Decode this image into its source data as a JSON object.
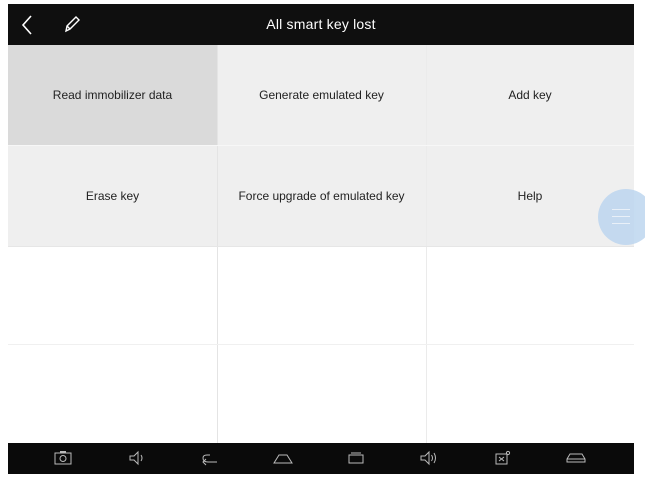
{
  "header": {
    "title": "All smart key lost",
    "back_icon": "chevron-left-icon",
    "edit_icon": "pencil-icon"
  },
  "menu": {
    "items": [
      {
        "label": "Read immobilizer data"
      },
      {
        "label": "Generate emulated key"
      },
      {
        "label": "Add key"
      },
      {
        "label": "Erase key"
      },
      {
        "label": "Force upgrade of emulated key"
      },
      {
        "label": "Help"
      }
    ]
  },
  "navbar": {
    "icons": [
      "screenshot-icon",
      "volume-down-icon",
      "back-icon",
      "home-icon",
      "recent-apps-icon",
      "volume-up-icon",
      "vci-icon",
      "vehicle-icon"
    ]
  },
  "colors": {
    "topbar": "#0f0f0f",
    "tile": "#efefef",
    "tile_active": "#dadada",
    "navbar": "#0a0a0a",
    "floating_button": "#bdd6ef"
  }
}
